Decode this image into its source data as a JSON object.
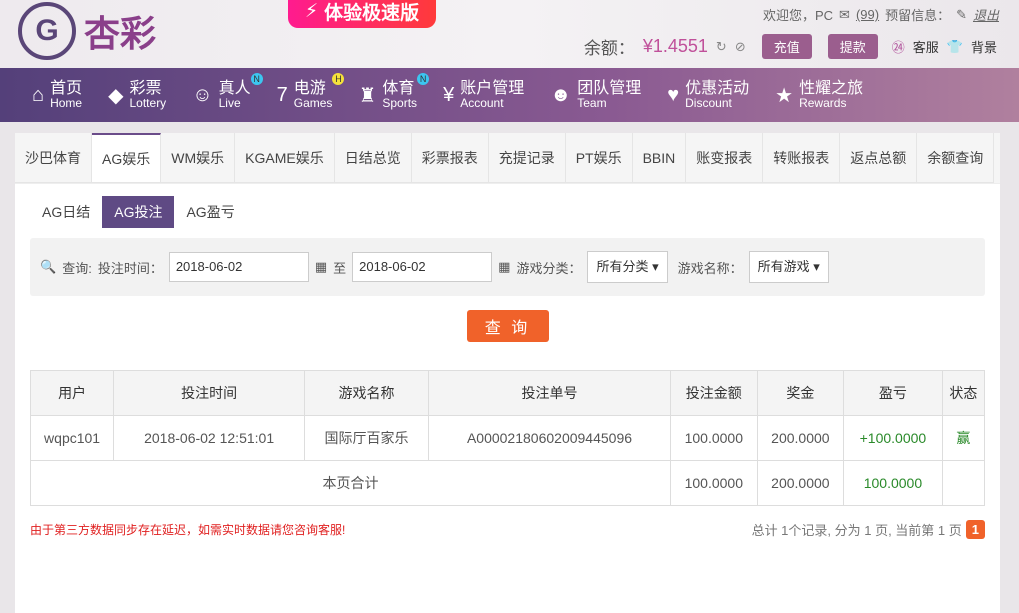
{
  "header": {
    "logo_text": "杏彩",
    "speed_label": "体验极速版",
    "welcome": "欢迎您，PC",
    "messages": "(99)",
    "reserved": "预留信息：",
    "logout": "退出",
    "balance_label": "余额：",
    "balance": "¥1.4551",
    "deposit": "充值",
    "withdraw": "提款",
    "service": "客服",
    "background": "背景"
  },
  "nav": [
    {
      "cn": "首页",
      "en": "Home",
      "icon": "⌂"
    },
    {
      "cn": "彩票",
      "en": "Lottery",
      "icon": "◆"
    },
    {
      "cn": "真人",
      "en": "Live",
      "icon": "☺",
      "badge": "N"
    },
    {
      "cn": "电游",
      "en": "Games",
      "icon": "7",
      "badge": "H"
    },
    {
      "cn": "体育",
      "en": "Sports",
      "icon": "♜",
      "badge": "N"
    },
    {
      "cn": "账户管理",
      "en": "Account",
      "icon": "¥"
    },
    {
      "cn": "团队管理",
      "en": "Team",
      "icon": "☻"
    },
    {
      "cn": "优惠活动",
      "en": "Discount",
      "icon": "♥"
    },
    {
      "cn": "性耀之旅",
      "en": "Rewards",
      "icon": "★"
    }
  ],
  "tabs": [
    "沙巴体育",
    "AG娱乐",
    "WM娱乐",
    "KGAME娱乐",
    "日结总览",
    "彩票报表",
    "充提记录",
    "PT娱乐",
    "BBIN",
    "账变报表",
    "转账报表",
    "返点总额",
    "余额查询"
  ],
  "subtabs": [
    "AG日结",
    "AG投注",
    "AG盈亏"
  ],
  "query": {
    "label": "查询:",
    "time_label": "投注时间：",
    "from": "2018-06-02",
    "to_label": "至",
    "to": "2018-06-02",
    "cat_label": "游戏分类：",
    "cat": "所有分类",
    "name_label": "游戏名称：",
    "name": "所有游戏",
    "button": "查 询"
  },
  "table": {
    "headers": [
      "用户",
      "投注时间",
      "游戏名称",
      "投注单号",
      "投注金额",
      "奖金",
      "盈亏",
      "状态"
    ],
    "rows": [
      [
        "wqpc101",
        "2018-06-02 12:51:01",
        "国际厅百家乐",
        "A00002180602009445096",
        "100.0000",
        "200.0000",
        "+100.0000",
        "赢"
      ]
    ],
    "total": {
      "label": "本页合计",
      "bet": "100.0000",
      "bonus": "200.0000",
      "profit": "100.0000"
    }
  },
  "notice": "由于第三方数据同步存在延迟，如需实时数据请您咨询客服!",
  "pager": {
    "text": "总计 1个记录, 分为 1 页, 当前第 1 页",
    "current": "1"
  }
}
